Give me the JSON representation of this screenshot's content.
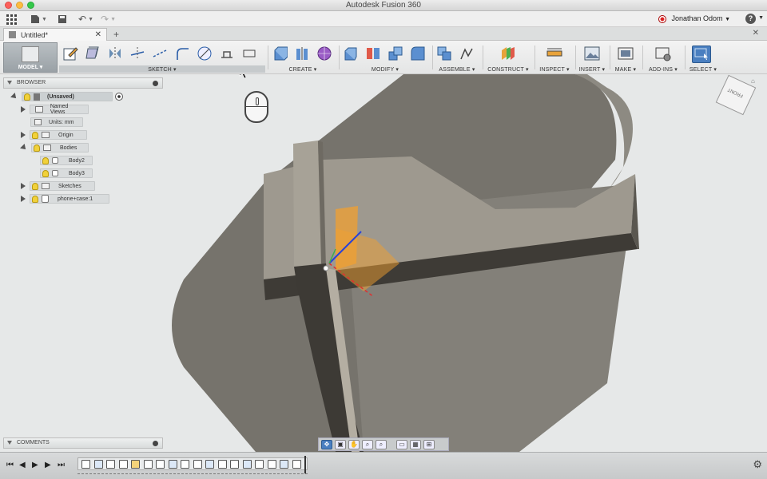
{
  "window": {
    "title": "Autodesk Fusion 360"
  },
  "quick_access": {
    "user_name": "Jonathan Odom",
    "help_label": "?"
  },
  "document_tab": {
    "title": "Untitled*",
    "close": "✕",
    "add": "+"
  },
  "toolbar": {
    "workspace_label": "MODEL",
    "groups": [
      {
        "label": "SKETCH"
      },
      {
        "label": "CREATE"
      },
      {
        "label": "MODIFY"
      },
      {
        "label": "ASSEMBLE"
      },
      {
        "label": "CONSTRUCT"
      },
      {
        "label": "INSPECT"
      },
      {
        "label": "INSERT"
      },
      {
        "label": "MAKE"
      },
      {
        "label": "ADD-INS"
      },
      {
        "label": "SELECT"
      }
    ]
  },
  "browser": {
    "title": "BROWSER",
    "nodes": [
      {
        "label": "(Unsaved)"
      },
      {
        "label": "Named Views"
      },
      {
        "label": "Units: mm"
      },
      {
        "label": "Origin"
      },
      {
        "label": "Bodies"
      },
      {
        "label": "Body2"
      },
      {
        "label": "Body3"
      },
      {
        "label": "Sketches"
      },
      {
        "label": "phone+case:1"
      }
    ]
  },
  "comments": {
    "title": "COMMENTS"
  },
  "viewcube": {
    "face_label": "FRONT"
  },
  "colors": {
    "accent": "#4a7fc0",
    "model_face": "#8a8477",
    "model_dark": "#4f4c46",
    "highlight": "#f0a030"
  },
  "timeline": {
    "item_count": 18
  }
}
